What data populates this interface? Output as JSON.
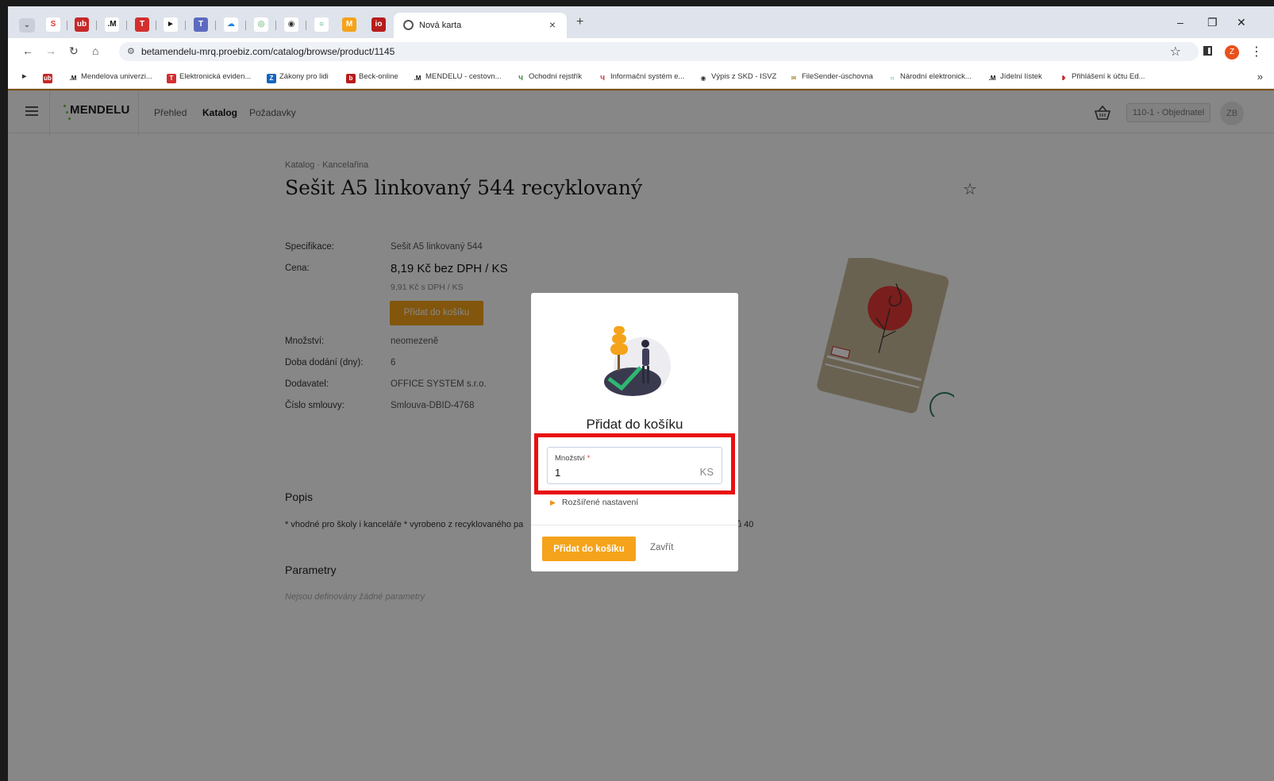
{
  "browser": {
    "tab_title": "Nová karta",
    "url": "betamendelu-mrq.proebiz.com/catalog/browse/product/1145",
    "profile_initial": "Z",
    "bookmarks": [
      {
        "label": "Mendelova univerzi...",
        "icon": "mendelu-icon"
      },
      {
        "label": "Elektronická eviden...",
        "icon": "t-icon"
      },
      {
        "label": "Zákony pro lidi",
        "icon": "z-icon"
      },
      {
        "label": "Beck-online",
        "icon": "b-icon"
      },
      {
        "label": "MENDELU - cestovn...",
        "icon": "mendelu-icon"
      },
      {
        "label": "Ochodní rejstřík",
        "icon": "justice-icon"
      },
      {
        "label": "Informační systém e...",
        "icon": "justice-icon"
      },
      {
        "label": "Výpis z SKD - ISVZ",
        "icon": "globe-icon"
      },
      {
        "label": "FileSender-úschovna",
        "icon": "filesender-icon"
      },
      {
        "label": "Národní elektronick...",
        "icon": "circle-icon"
      },
      {
        "label": "Jídelní lístek",
        "icon": "mendelu-icon"
      },
      {
        "label": "Přihlášení k účtu Ed...",
        "icon": "ed-icon"
      }
    ],
    "colors": {
      "accent": "#f5a31a",
      "highlight": "#e80f12"
    }
  },
  "app": {
    "logo": "MENDELU",
    "nav": [
      "Přehled",
      "Katalog",
      "Požadavky"
    ],
    "role": "110-1 - Objednatel",
    "avatar": "ZB"
  },
  "product": {
    "breadcrumb": "Katalog  ·  Kancelařina",
    "title": "Sešit A5 linkovaný 544 recyklovaný",
    "spec_label": "Specifikace:",
    "spec_value": "Sešit A5 linkovaný 544",
    "price_label": "Cena:",
    "price_main": "8,19 Kč bez DPH / KS",
    "price_vat": "9,91 Kč s DPH / KS",
    "add_button": "Přidat do košíku",
    "qty_label": "Množství:",
    "qty_value": "neomezeně",
    "delivery_label": "Doba dodání (dny):",
    "delivery_value": "6",
    "supplier_label": "Dodavatel:",
    "supplier_value": "OFFICE SYSTEM s.r.o.",
    "contract_label": "Číslo smlouvy:",
    "contract_value": "Smlouva-DBID-4768",
    "description_heading": "Popis",
    "description_start": "* vhodné pro školy i kanceláře * vyrobeno z recyklovaného pa",
    "description_end": "ů 40",
    "parameters_heading": "Parametry",
    "parameters_empty": "Nejsou definovány žádné parametry"
  },
  "modal": {
    "title": "Přidat do košíku",
    "qty_label": "Množství",
    "qty_required": "*",
    "qty_value": "1",
    "qty_unit": "KS",
    "advanced": "Rozšířené nastavení",
    "add_button": "Přidat do košíku",
    "close_button": "Zavřít"
  }
}
